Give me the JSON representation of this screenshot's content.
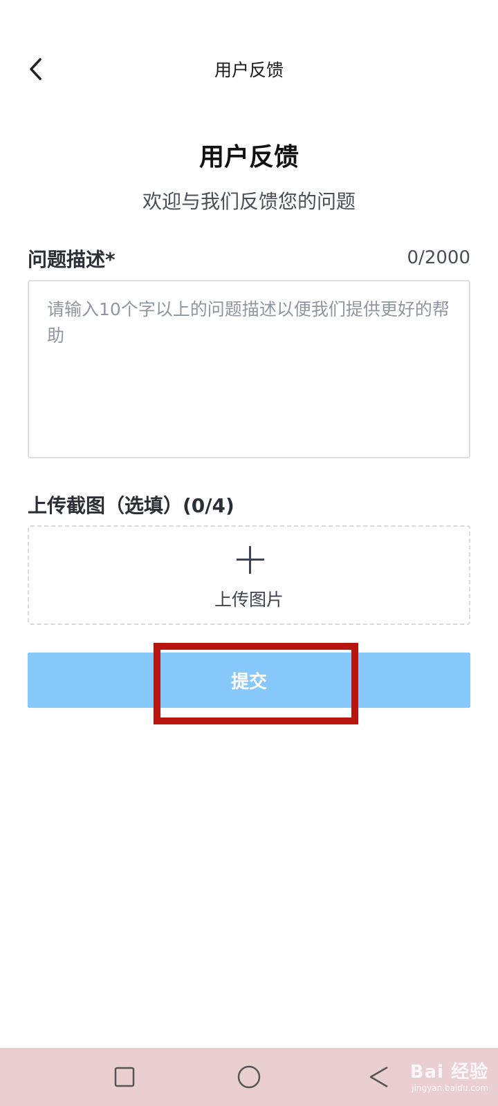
{
  "header": {
    "title": "用户反馈"
  },
  "main": {
    "title": "用户反馈",
    "subtitle": "欢迎与我们反馈您的问题"
  },
  "description": {
    "label": "问题描述*",
    "count": "0/2000",
    "placeholder": "请输入10个字以上的问题描述以便我们提供更好的帮助"
  },
  "upload": {
    "label": "上传截图（选填）(0/4)",
    "button_text": "上传图片"
  },
  "submit": {
    "label": "提交"
  },
  "watermark": {
    "text": "Bai 经验",
    "sub": "jingyan.baidu.com"
  },
  "colors": {
    "submit_bg": "#87c8fb",
    "highlight": "#b8150f",
    "nav_bg": "#e9cfd2"
  },
  "icons": {
    "back": "chevron-left-icon",
    "plus": "plus-icon",
    "nav_recent": "square-icon",
    "nav_home": "circle-icon",
    "nav_back": "triangle-back-icon"
  }
}
